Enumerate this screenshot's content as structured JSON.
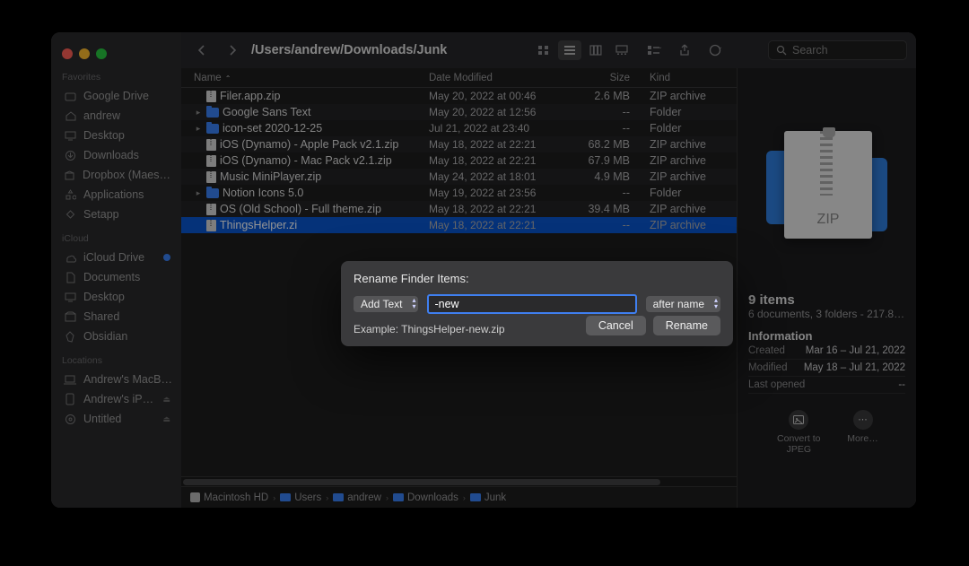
{
  "window": {
    "title_path": "/Users/andrew/Downloads/Junk",
    "search_placeholder": "Search"
  },
  "sidebar": {
    "sections": [
      {
        "label": "Favorites",
        "items": [
          {
            "icon": "drive",
            "label": "Google Drive"
          },
          {
            "icon": "home",
            "label": "andrew"
          },
          {
            "icon": "desktop",
            "label": "Desktop"
          },
          {
            "icon": "download",
            "label": "Downloads"
          },
          {
            "icon": "box",
            "label": "Dropbox (Maes…"
          },
          {
            "icon": "apps",
            "label": "Applications"
          },
          {
            "icon": "setapp",
            "label": "Setapp"
          }
        ]
      },
      {
        "label": "iCloud",
        "items": [
          {
            "icon": "cloud",
            "label": "iCloud Drive",
            "badge": "dot"
          },
          {
            "icon": "doc",
            "label": "Documents"
          },
          {
            "icon": "desktop",
            "label": "Desktop"
          },
          {
            "icon": "shared",
            "label": "Shared"
          },
          {
            "icon": "obsidian",
            "label": "Obsidian"
          }
        ]
      },
      {
        "label": "Locations",
        "items": [
          {
            "icon": "laptop",
            "label": "Andrew's MacB…"
          },
          {
            "icon": "phone",
            "label": "Andrew's iP…",
            "eject": true
          },
          {
            "icon": "disk",
            "label": "Untitled",
            "eject": true
          }
        ]
      }
    ]
  },
  "columns": {
    "name": "Name",
    "date": "Date Modified",
    "size": "Size",
    "kind": "Kind"
  },
  "files": [
    {
      "exp": false,
      "type": "zip",
      "name": "Filer.app.zip",
      "date": "May 20, 2022 at 00:46",
      "size": "2.6 MB",
      "kind": "ZIP archive"
    },
    {
      "exp": true,
      "type": "folder",
      "name": "Google Sans Text",
      "date": "May 20, 2022 at 12:56",
      "size": "--",
      "kind": "Folder"
    },
    {
      "exp": true,
      "type": "folder",
      "name": "icon-set 2020-12-25",
      "date": "Jul 21, 2022 at 23:40",
      "size": "--",
      "kind": "Folder"
    },
    {
      "exp": false,
      "type": "zip",
      "name": "iOS (Dynamo) - Apple Pack v2.1.zip",
      "date": "May 18, 2022 at 22:21",
      "size": "68.2 MB",
      "kind": "ZIP archive"
    },
    {
      "exp": false,
      "type": "zip",
      "name": "iOS (Dynamo) - Mac Pack v2.1.zip",
      "date": "May 18, 2022 at 22:21",
      "size": "67.9 MB",
      "kind": "ZIP archive"
    },
    {
      "exp": false,
      "type": "zip",
      "name": "Music MiniPlayer.zip",
      "date": "May 24, 2022 at 18:01",
      "size": "4.9 MB",
      "kind": "ZIP archive"
    },
    {
      "exp": true,
      "type": "folder",
      "name": "Notion Icons 5.0",
      "date": "May 19, 2022 at 23:56",
      "size": "--",
      "kind": "Folder"
    },
    {
      "exp": false,
      "type": "zip",
      "name": "OS (Old School) - Full theme.zip",
      "date": "May 18, 2022 at 22:21",
      "size": "39.4 MB",
      "kind": "ZIP archive"
    },
    {
      "exp": false,
      "type": "zip",
      "name": "ThingsHelper.zi",
      "date": "May 18, 2022 at 22:21",
      "size": "--",
      "kind": "ZIP archive",
      "sel": true,
      "truncated": true
    }
  ],
  "pathbar": [
    "Macintosh HD",
    "Users",
    "andrew",
    "Downloads",
    "Junk"
  ],
  "preview": {
    "badge": "ZIP",
    "count": "9 items",
    "summary": "6 documents, 3 folders - 217.8…",
    "section": "Information",
    "rows": [
      {
        "k": "Created",
        "v": "Mar 16 – Jul 21, 2022"
      },
      {
        "k": "Modified",
        "v": "May 18 – Jul 21, 2022"
      },
      {
        "k": "Last opened",
        "v": "--"
      }
    ],
    "actions": [
      {
        "icon": "jpeg",
        "label": "Convert to JPEG"
      },
      {
        "icon": "more",
        "label": "More…"
      }
    ]
  },
  "modal": {
    "title": "Rename Finder Items:",
    "mode": "Add Text",
    "text": "-new",
    "position": "after name",
    "example_label": "Example: ",
    "example": "ThingsHelper-new.zip",
    "cancel": "Cancel",
    "confirm": "Rename"
  }
}
